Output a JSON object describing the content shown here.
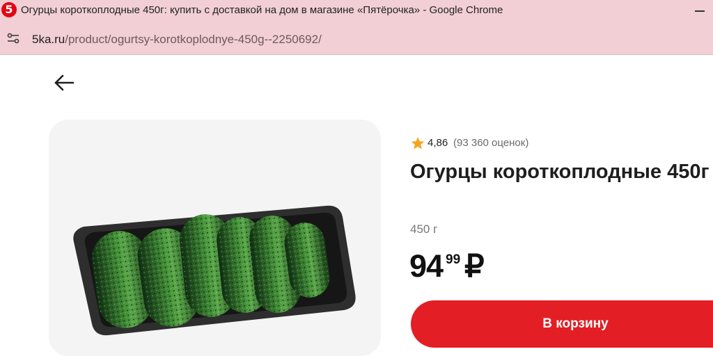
{
  "browser": {
    "window_title": "Огурцы короткоплодные 450г: купить с доставкой на дом в магазине «Пятёрочка» - Google Chrome",
    "logo_text": "5",
    "url_host": "5ka.ru",
    "url_path": "/product/ogurtsy-korotkoplodnye-450g--2250692/"
  },
  "product": {
    "rating_value": "4,86",
    "rating_count": "(93 360 оценок)",
    "title": "Огурцы короткоплодные 450г",
    "weight": "450 г",
    "price_integer": "94",
    "price_fraction": "99",
    "currency": "₽",
    "add_to_cart_label": "В корзину"
  },
  "colors": {
    "brand_red": "#e31e24",
    "chrome_pink": "#f1cfd4",
    "star_gold": "#f4a51c"
  },
  "icons": {
    "back": "arrow-left-icon",
    "site_info": "tune-icon",
    "rating": "star-icon",
    "window": "minimize-icon"
  }
}
